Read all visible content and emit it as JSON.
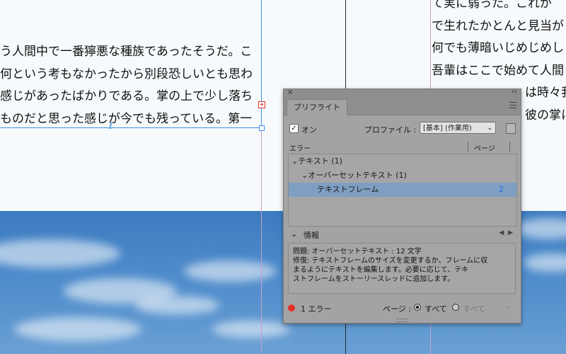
{
  "document": {
    "left_text_lines": [
      "う人間中で一番獰悪な種族であったそうだ。こ",
      "何という考もなかったから別段恐しいとも思わ",
      "感じがあったばかりである。掌の上で少し落ち",
      "ものだと思った感じが今でも残っている。第一"
    ],
    "right_text_lines": [
      "て実に弱った。これが",
      "で生れたかとんと見当が",
      "何でも薄暗いじめじめし",
      "吾輩はここで始めて人間",
      "は時々我",
      "彼の掌に"
    ],
    "overset_marker": "+"
  },
  "panel": {
    "close_glyph": "×",
    "collapse_glyph": "‹‹",
    "tab_label": "プリフライト",
    "on_checked": true,
    "on_label": "オン",
    "profile_label": "プロファイル :",
    "profile_value": "[基本] (作業用)",
    "col_error": "エラー",
    "col_page": "ページ",
    "tree": [
      {
        "label": "テキスト (1)"
      },
      {
        "label": "オーバーセットテキスト (1)"
      },
      {
        "label": "テキストフレーム",
        "page": "2"
      }
    ],
    "info_title": "情報",
    "info_text": [
      "問題: オーバーセットテキスト : 12 文字",
      "修復: テキストフレームのサイズを変更するか、フレームに収",
      "まるようにテキストを編集します。必要に応じて、テキ",
      "ストフレームをストーリースレッドに追加します。"
    ],
    "error_count": "1 エラー",
    "page_label": "ページ :",
    "radio_all": "すべて",
    "radio_other": "すべて",
    "colors": {
      "error_dot": "#e0302a",
      "selected_row": "#7f9fc2",
      "page_link": "#2a6bd6"
    }
  }
}
